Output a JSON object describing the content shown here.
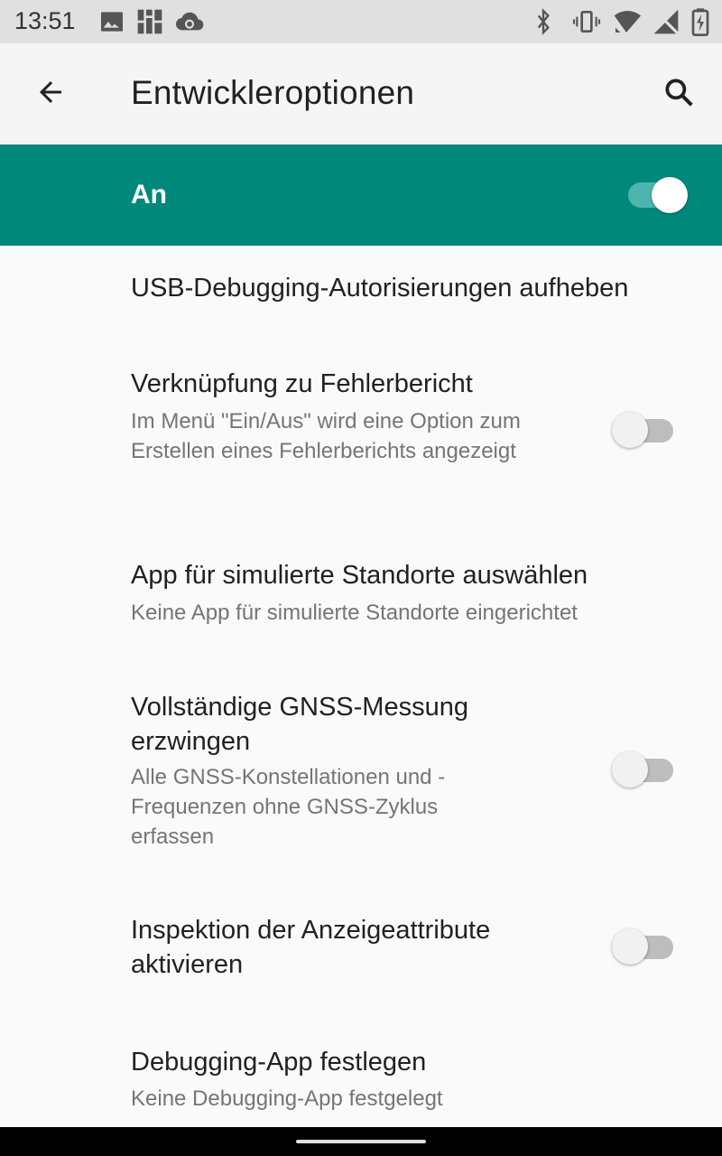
{
  "status_bar": {
    "time": "13:51",
    "left_icons": [
      "image-icon",
      "grid-app-icon",
      "cloud-sync-icon"
    ],
    "right_icons": [
      "bluetooth-icon",
      "vibrate-icon",
      "wifi-icon",
      "no-signal-icon",
      "battery-charging-icon"
    ]
  },
  "app_bar": {
    "title": "Entwickleroptionen",
    "back_icon": "arrow-back-icon",
    "search_icon": "search-icon"
  },
  "master_switch": {
    "label": "An",
    "state": true,
    "accent_color": "#00897b"
  },
  "items": [
    {
      "title": "USB-Debugging-Autorisierungen aufheben"
    },
    {
      "title": "Verknüpfung zu Fehlerbericht",
      "summary": "Im Menü \"Ein/Aus\" wird eine Option zum Erstellen eines Fehlerberichts angezeigt",
      "toggle": false
    },
    {
      "title": "App für simulierte Standorte auswählen",
      "summary": "Keine App für simulierte Standorte eingerichtet"
    },
    {
      "title": "Vollständige GNSS-Messung erzwingen",
      "summary": "Alle GNSS-Konstellationen und -Frequenzen ohne GNSS-Zyklus erfassen",
      "toggle": false
    },
    {
      "title": "Inspektion der Anzeigeattribute aktivieren",
      "toggle": false
    },
    {
      "title": "Debugging-App festlegen",
      "summary": "Keine Debugging-App festgelegt"
    }
  ]
}
